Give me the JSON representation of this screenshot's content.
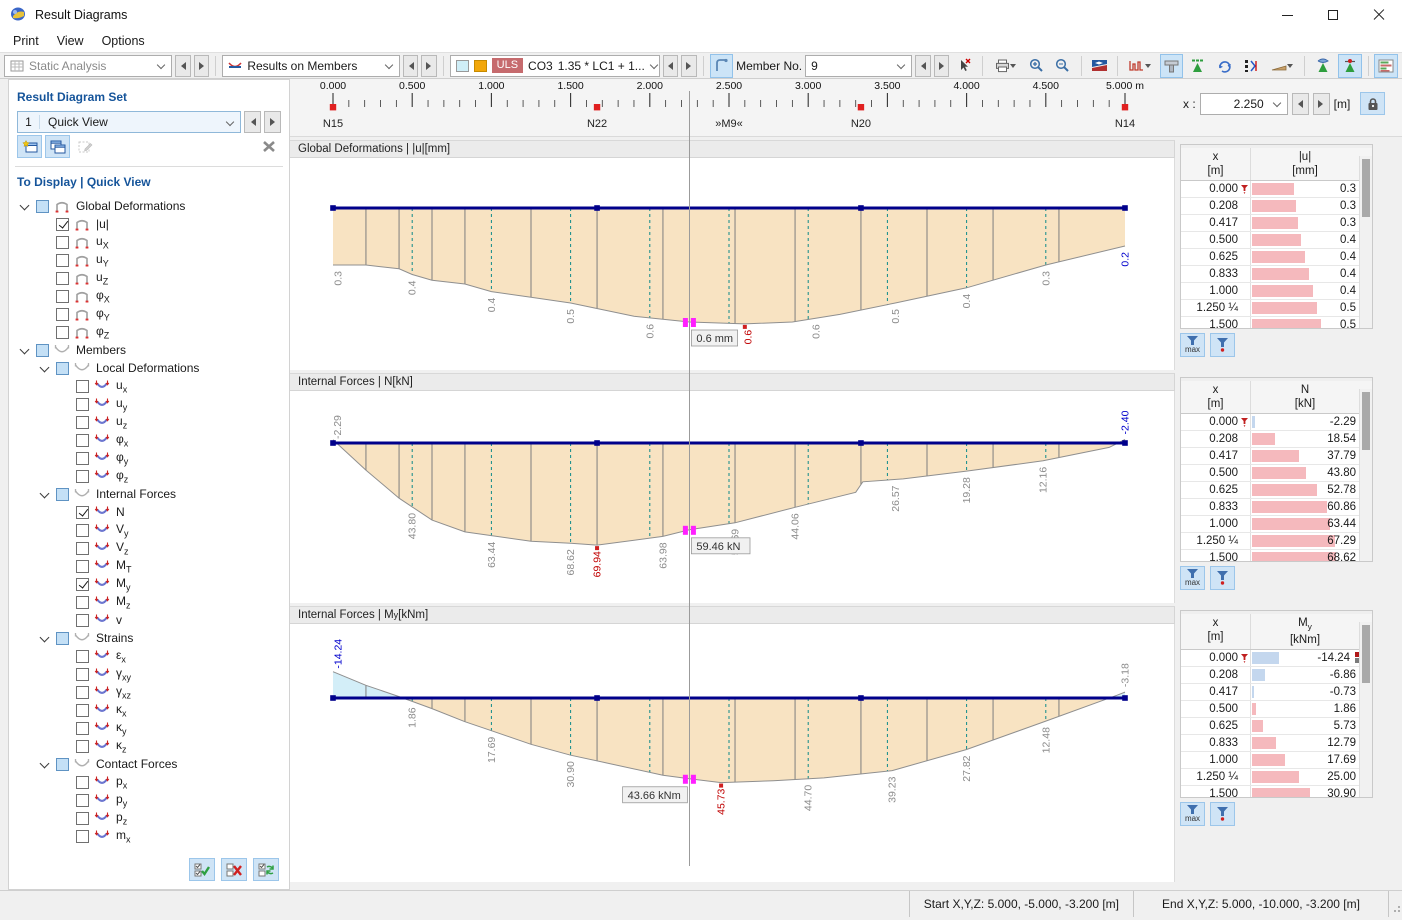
{
  "window": {
    "title": "Result Diagrams"
  },
  "menu": {
    "items": [
      "Print",
      "View",
      "Options"
    ]
  },
  "toolbar": {
    "analysis": "Static Analysis",
    "results": "Results on Members",
    "uls": "ULS",
    "co": "CO3",
    "combo": "1.35 * LC1 + 1...",
    "member_label": "Member No.",
    "member_value": "9"
  },
  "sidebar": {
    "set_header": "Result Diagram Set",
    "set_number": "1",
    "set_name": "Quick View",
    "display_header": "To Display | Quick View",
    "tree": [
      {
        "level": 0,
        "exp": true,
        "state": "mixed",
        "icon": "frame",
        "label": "Global Deformations"
      },
      {
        "level": 1,
        "state": "on",
        "icon": "frame",
        "label": "|u|"
      },
      {
        "level": 1,
        "state": "off",
        "icon": "frame",
        "label": "u",
        "sub": "X"
      },
      {
        "level": 1,
        "state": "off",
        "icon": "frame",
        "label": "u",
        "sub": "Y"
      },
      {
        "level": 1,
        "state": "off",
        "icon": "frame",
        "label": "u",
        "sub": "Z"
      },
      {
        "level": 1,
        "state": "off",
        "icon": "frame",
        "label": "φ",
        "sub": "X"
      },
      {
        "level": 1,
        "state": "off",
        "icon": "frame",
        "label": "φ",
        "sub": "Y"
      },
      {
        "level": 1,
        "state": "off",
        "icon": "frame",
        "label": "φ",
        "sub": "Z"
      },
      {
        "level": 0,
        "exp": true,
        "state": "mixed",
        "icon": "ugray",
        "label": "Members"
      },
      {
        "level": 1,
        "exp": true,
        "state": "mixed",
        "icon": "ugray",
        "label": "Local Deformations"
      },
      {
        "level": 2,
        "state": "off",
        "icon": "ucolor",
        "label": "u",
        "sub": "x"
      },
      {
        "level": 2,
        "state": "off",
        "icon": "ucolor",
        "label": "u",
        "sub": "y"
      },
      {
        "level": 2,
        "state": "off",
        "icon": "ucolor",
        "label": "u",
        "sub": "z"
      },
      {
        "level": 2,
        "state": "off",
        "icon": "ucolor",
        "label": "φ",
        "sub": "x"
      },
      {
        "level": 2,
        "state": "off",
        "icon": "ucolor",
        "label": "φ",
        "sub": "y"
      },
      {
        "level": 2,
        "state": "off",
        "icon": "ucolor",
        "label": "φ",
        "sub": "z"
      },
      {
        "level": 1,
        "exp": true,
        "state": "mixed",
        "icon": "ugray",
        "label": "Internal Forces"
      },
      {
        "level": 2,
        "state": "on",
        "icon": "ucolor",
        "label": "N"
      },
      {
        "level": 2,
        "state": "off",
        "icon": "ucolor",
        "label": "V",
        "sub": "y"
      },
      {
        "level": 2,
        "state": "off",
        "icon": "ucolor",
        "label": "V",
        "sub": "z"
      },
      {
        "level": 2,
        "state": "off",
        "icon": "ucolor",
        "label": "M",
        "sub": "T"
      },
      {
        "level": 2,
        "state": "on",
        "icon": "ucolor",
        "label": "M",
        "sub": "y"
      },
      {
        "level": 2,
        "state": "off",
        "icon": "ucolor",
        "label": "M",
        "sub": "z"
      },
      {
        "level": 2,
        "state": "off",
        "icon": "ucolor",
        "label": "v"
      },
      {
        "level": 1,
        "exp": true,
        "state": "mixed",
        "icon": "ugray",
        "label": "Strains"
      },
      {
        "level": 2,
        "state": "off",
        "icon": "ucolor",
        "label": "ε",
        "sub": "x"
      },
      {
        "level": 2,
        "state": "off",
        "icon": "ucolor",
        "label": "γ",
        "sub": "xy"
      },
      {
        "level": 2,
        "state": "off",
        "icon": "ucolor",
        "label": "γ",
        "sub": "xz"
      },
      {
        "level": 2,
        "state": "off",
        "icon": "ucolor",
        "label": "κ",
        "sub": "x"
      },
      {
        "level": 2,
        "state": "off",
        "icon": "ucolor",
        "label": "κ",
        "sub": "y"
      },
      {
        "level": 2,
        "state": "off",
        "icon": "ucolor",
        "label": "κ",
        "sub": "z"
      },
      {
        "level": 1,
        "exp": true,
        "state": "mixed",
        "icon": "ugray",
        "label": "Contact Forces"
      },
      {
        "level": 2,
        "state": "off",
        "icon": "ucolor",
        "label": "p",
        "sub": "x"
      },
      {
        "level": 2,
        "state": "off",
        "icon": "ucolor",
        "label": "p",
        "sub": "y"
      },
      {
        "level": 2,
        "state": "off",
        "icon": "ucolor",
        "label": "p",
        "sub": "z"
      },
      {
        "level": 2,
        "state": "off",
        "icon": "ucolor",
        "label": "m",
        "sub": "x"
      }
    ]
  },
  "ruler": {
    "unit": "m",
    "max": 5,
    "tick_step": 0.5,
    "minor_step": 0.1,
    "nodes": [
      {
        "name": "N15",
        "x": 0
      },
      {
        "name": "N22",
        "x": 1.667
      },
      {
        "name": "»M9«",
        "x": 2.5,
        "member": true
      },
      {
        "name": "N20",
        "x": 3.333
      },
      {
        "name": "N14",
        "x": 5
      }
    ],
    "x_label": "x :",
    "x_value": "2.250",
    "x_unit": "[m]"
  },
  "stations": {
    "solid": [
      0.208,
      0.417,
      0.625,
      0.833,
      1.25,
      1.667,
      2.083,
      2.538,
      2.917,
      3.333,
      3.75,
      4.167,
      4.583
    ],
    "dashed": [
      0.5,
      1,
      1.5,
      2,
      2.5,
      3,
      3.5,
      4,
      4.5
    ]
  },
  "colors": {
    "accent_blue": "#cce4f7",
    "member_line": "#00008b",
    "fill_positive": "#f8e3c2",
    "fill_negative": "#d3eef8",
    "bar_positive": "#f5b9bd",
    "bar_negative": "#c4d7ee",
    "uls_badge": "#c66b6e",
    "station_dashed": "#0d8a8a",
    "cursor_magenta": "#ff1fff",
    "label_red": "#c00000",
    "label_blue": "#0000cc",
    "label_gray": "#8c8c8c"
  },
  "chart_data": [
    {
      "type": "area",
      "title": "Global Deformations | |u| [mm]",
      "xlabel": "x [m]",
      "ylabel": "|u| [mm]",
      "x_range": [
        0,
        5
      ],
      "x": [
        0,
        0.208,
        0.417,
        0.5,
        0.625,
        0.833,
        1,
        1.25,
        1.5,
        1.9,
        2.25,
        2.6,
        2.9,
        3.2,
        3.55,
        4,
        4.5,
        5
      ],
      "values": [
        0.3,
        0.3,
        0.32,
        0.35,
        0.38,
        0.4,
        0.44,
        0.47,
        0.5,
        0.57,
        0.6,
        0.61,
        0.6,
        0.56,
        0.5,
        0.42,
        0.3,
        0.2
      ],
      "labels": [
        {
          "x": 0.03,
          "text": "0.3",
          "color": "gray"
        },
        {
          "x": 0.5,
          "text": "0.4",
          "color": "gray"
        },
        {
          "x": 1.0,
          "text": "0.4",
          "color": "gray"
        },
        {
          "x": 1.5,
          "text": "0.5",
          "color": "gray"
        },
        {
          "x": 2.0,
          "text": "0.6",
          "color": "gray"
        },
        {
          "x": 2.62,
          "text": "0.6",
          "color": "red"
        },
        {
          "x": 3.05,
          "text": "0.6",
          "color": "gray"
        },
        {
          "x": 3.55,
          "text": "0.5",
          "color": "gray"
        },
        {
          "x": 4.0,
          "text": "0.4",
          "color": "gray"
        },
        {
          "x": 4.5,
          "text": "0.3",
          "color": "gray"
        },
        {
          "x": 5.0,
          "text": "0.2",
          "color": "blue"
        }
      ],
      "cursor": {
        "x": 2.25,
        "value": 0.6,
        "tooltip": "0.6 mm",
        "side": "right"
      },
      "max": {
        "x": 2.6,
        "value": 0.61
      }
    },
    {
      "type": "area",
      "title": "Internal Forces | N [kN]",
      "xlabel": "x [m]",
      "ylabel": "N [kN]",
      "x_range": [
        0,
        5
      ],
      "x": [
        0,
        0.208,
        0.417,
        0.5,
        0.625,
        0.833,
        1,
        1.25,
        1.5,
        1.667,
        2.083,
        2.25,
        2.538,
        2.917,
        3.3,
        3.345,
        3.6,
        4,
        4.483,
        4.9,
        5
      ],
      "values": [
        -2.29,
        18.54,
        37.79,
        43.8,
        52.78,
        60.86,
        63.44,
        67.29,
        68.62,
        69.94,
        63.98,
        59.46,
        54.69,
        44.06,
        33.8,
        26.57,
        24.6,
        19.28,
        12.16,
        3,
        -2.4
      ],
      "labels": [
        {
          "x": 0.03,
          "text": "-2.29",
          "color": "gray",
          "above": true
        },
        {
          "x": 0.5,
          "text": "43.80",
          "color": "gray"
        },
        {
          "x": 1.0,
          "text": "63.44",
          "color": "gray"
        },
        {
          "x": 1.5,
          "text": "68.62",
          "color": "gray"
        },
        {
          "x": 1.667,
          "text": "69.94",
          "color": "red"
        },
        {
          "x": 2.083,
          "text": "63.98",
          "color": "gray"
        },
        {
          "x": 2.538,
          "text": "54.69",
          "color": "gray"
        },
        {
          "x": 2.917,
          "text": "44.06",
          "color": "gray"
        },
        {
          "x": 3.55,
          "text": "26.57",
          "color": "gray"
        },
        {
          "x": 4.0,
          "text": "19.28",
          "color": "gray"
        },
        {
          "x": 4.483,
          "text": "12.16",
          "color": "gray"
        },
        {
          "x": 5.0,
          "text": "-2.40",
          "color": "blue",
          "above": true
        }
      ],
      "cursor": {
        "x": 2.25,
        "value": 59.46,
        "tooltip": "59.46 kN",
        "side": "right"
      },
      "max": {
        "x": 1.667,
        "value": 69.94
      }
    },
    {
      "type": "area",
      "title": "Internal Forces | My [kNm]",
      "xlabel": "x [m]",
      "ylabel": "My [kNm]",
      "x_range": [
        0,
        5
      ],
      "x": [
        0,
        0.208,
        0.417,
        0.44,
        0.5,
        0.625,
        0.833,
        1,
        1.25,
        1.5,
        1.75,
        2.083,
        2.25,
        2.45,
        2.78,
        3.1,
        3.53,
        4,
        4.5,
        4.95,
        5
      ],
      "values": [
        -14.24,
        -6.86,
        -0.73,
        0,
        1.86,
        5.73,
        12.79,
        17.69,
        25,
        30.9,
        35.5,
        41.8,
        43.66,
        45.73,
        44.7,
        43.2,
        39.23,
        27.82,
        12.48,
        -1.5,
        -3.18
      ],
      "labels": [
        {
          "x": 0.03,
          "text": "-14.24",
          "color": "blue",
          "above": true
        },
        {
          "x": 0.5,
          "text": "1.86",
          "color": "gray"
        },
        {
          "x": 1.0,
          "text": "17.69",
          "color": "gray"
        },
        {
          "x": 1.5,
          "text": "30.90",
          "color": "gray"
        },
        {
          "x": 2.45,
          "text": "45.73",
          "color": "red"
        },
        {
          "x": 3.0,
          "text": "44.70",
          "color": "gray"
        },
        {
          "x": 3.53,
          "text": "39.23",
          "color": "gray"
        },
        {
          "x": 4.0,
          "text": "27.82",
          "color": "gray"
        },
        {
          "x": 4.5,
          "text": "12.48",
          "color": "gray"
        },
        {
          "x": 5.0,
          "text": "-3.18",
          "color": "gray",
          "above": true
        }
      ],
      "cursor": {
        "x": 2.25,
        "value": 43.66,
        "tooltip": "43.66 kNm",
        "side": "left"
      },
      "max": {
        "x": 2.45,
        "value": 45.73
      }
    }
  ],
  "panels": [
    {
      "title_main": "Global Deformations | |u|",
      "title_sub": "",
      "title_tail": " [mm]",
      "table": {
        "col1": "x",
        "col1_unit": "[m]",
        "col2": "|u|",
        "col2_sub": "",
        "col2_unit": "[mm]",
        "bar_max": 0.62,
        "rows": [
          {
            "x": "0.000",
            "display": "0.3",
            "bar": 0.3,
            "x_icon": true
          },
          {
            "x": "0.208",
            "display": "0.3",
            "bar": 0.315
          },
          {
            "x": "0.417",
            "display": "0.3",
            "bar": 0.33
          },
          {
            "x": "0.500",
            "display": "0.4",
            "bar": 0.35
          },
          {
            "x": "0.625",
            "display": "0.4",
            "bar": 0.38
          },
          {
            "x": "0.833",
            "display": "0.4",
            "bar": 0.41
          },
          {
            "x": "1.000",
            "display": "0.4",
            "bar": 0.44
          },
          {
            "x": "1.250 ¼",
            "display": "0.5",
            "bar": 0.47
          },
          {
            "x": "1.500",
            "display": "0.5",
            "bar": 0.5
          }
        ]
      }
    },
    {
      "title_main": "Internal Forces | N",
      "title_sub": "",
      "title_tail": " [kN]",
      "table": {
        "col1": "x",
        "col1_unit": "[m]",
        "col2": "N",
        "col2_sub": "",
        "col2_unit": "[kN]",
        "bar_max": 69.94,
        "rows": [
          {
            "x": "0.000",
            "display": "-2.29",
            "bar": -2.29,
            "x_icon": true
          },
          {
            "x": "0.208",
            "display": "18.54",
            "bar": 18.54
          },
          {
            "x": "0.417",
            "display": "37.79",
            "bar": 37.79
          },
          {
            "x": "0.500",
            "display": "43.80",
            "bar": 43.8
          },
          {
            "x": "0.625",
            "display": "52.78",
            "bar": 52.78
          },
          {
            "x": "0.833",
            "display": "60.86",
            "bar": 60.86
          },
          {
            "x": "1.000",
            "display": "63.44",
            "bar": 63.44
          },
          {
            "x": "1.250 ¼",
            "display": "67.29",
            "bar": 67.29
          },
          {
            "x": "1.500",
            "display": "68.62",
            "bar": 68.62
          }
        ]
      }
    },
    {
      "title_main": "Internal Forces | M",
      "title_sub": "y",
      "title_tail": " [kNm]",
      "table": {
        "col1": "x",
        "col1_unit": "[m]",
        "col2": "M",
        "col2_sub": "y",
        "col2_unit": "[kNm]",
        "bar_max": 45.73,
        "rows": [
          {
            "x": "0.000",
            "display": "-14.24",
            "bar": -14.24,
            "x_icon": true,
            "v_icons": true
          },
          {
            "x": "0.208",
            "display": "-6.86",
            "bar": -6.86
          },
          {
            "x": "0.417",
            "display": "-0.73",
            "bar": -0.73
          },
          {
            "x": "0.500",
            "display": "1.86",
            "bar": 1.86
          },
          {
            "x": "0.625",
            "display": "5.73",
            "bar": 5.73
          },
          {
            "x": "0.833",
            "display": "12.79",
            "bar": 12.79
          },
          {
            "x": "1.000",
            "display": "17.69",
            "bar": 17.69
          },
          {
            "x": "1.250 ¼",
            "display": "25.00",
            "bar": 25
          },
          {
            "x": "1.500",
            "display": "30.90",
            "bar": 30.9
          }
        ]
      }
    }
  ],
  "table_buttons": {
    "max_label": "max"
  },
  "statusbar": {
    "start": "Start X,Y,Z: 5.000, -5.000, -3.200 [m]",
    "end": "End X,Y,Z: 5.000, -10.000, -3.200 [m]"
  }
}
